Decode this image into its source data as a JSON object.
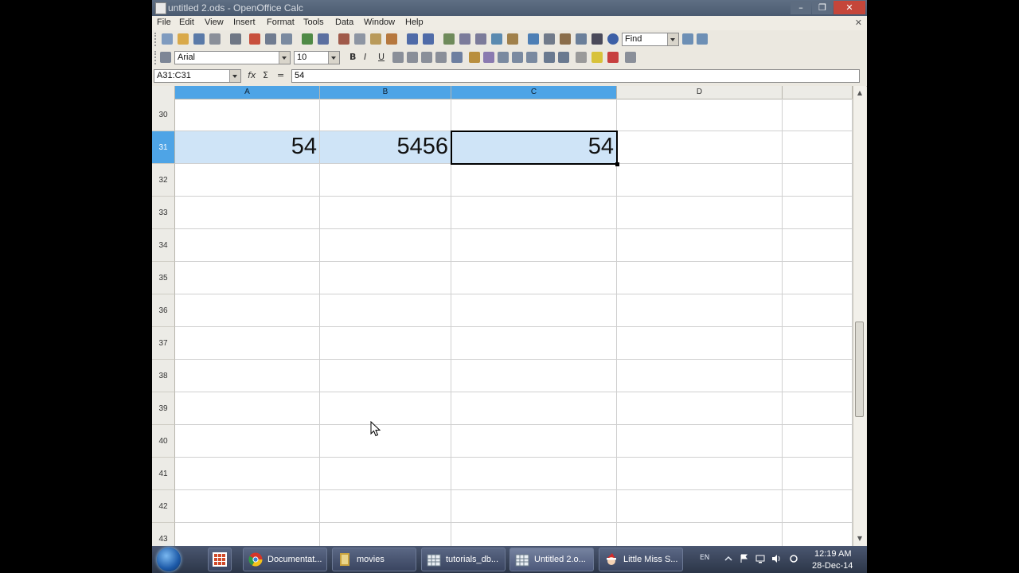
{
  "window": {
    "title": "untitled 2.ods - OpenOffice Calc",
    "minimize_glyph": "–",
    "maximize_glyph": "❐",
    "close_glyph": "✕"
  },
  "menu": {
    "items": [
      "File",
      "Edit",
      "View",
      "Insert",
      "Format",
      "Tools",
      "Data",
      "Window",
      "Help"
    ],
    "close_doc": "✕"
  },
  "toolbar_standard": {
    "find_value": "Find"
  },
  "toolbar_formatting": {
    "font_name": "Arial",
    "font_size": "10",
    "bold": "B",
    "italic": "I",
    "underline": "U"
  },
  "formula_bar": {
    "name_box": "A31:C31",
    "function_wizard": "fx",
    "sum": "Σ",
    "equals": "=",
    "content": "54"
  },
  "sheet": {
    "columns": [
      "A",
      "B",
      "C",
      "D"
    ],
    "selected_columns": [
      "A",
      "B",
      "C"
    ],
    "rows": [
      "30",
      "31",
      "32",
      "33",
      "34",
      "35",
      "36",
      "37",
      "38",
      "39",
      "40",
      "41",
      "42",
      "43"
    ],
    "selected_row": "31",
    "cells": {
      "A31": "54",
      "B31": "5456",
      "C31": "54"
    },
    "active_cell": "C31"
  },
  "taskbar": {
    "buttons": [
      {
        "label": "",
        "icon": "grid-app-icon"
      },
      {
        "label": "Documentat...",
        "icon": "chrome-icon"
      },
      {
        "label": "movies",
        "icon": "folder-icon"
      },
      {
        "label": "tutorials_db...",
        "icon": "calc-icon"
      },
      {
        "label": "Untitled 2.o...",
        "icon": "calc-icon",
        "active": true
      },
      {
        "label": "Little Miss S...",
        "icon": "santa-icon"
      }
    ],
    "language": "EN",
    "time": "12:19 AM",
    "date": "28-Dec-14"
  },
  "colors": {
    "selection_header": "#4ea4e6",
    "selection_fill": "#cfe4f7",
    "window_bg": "#ece9df"
  }
}
